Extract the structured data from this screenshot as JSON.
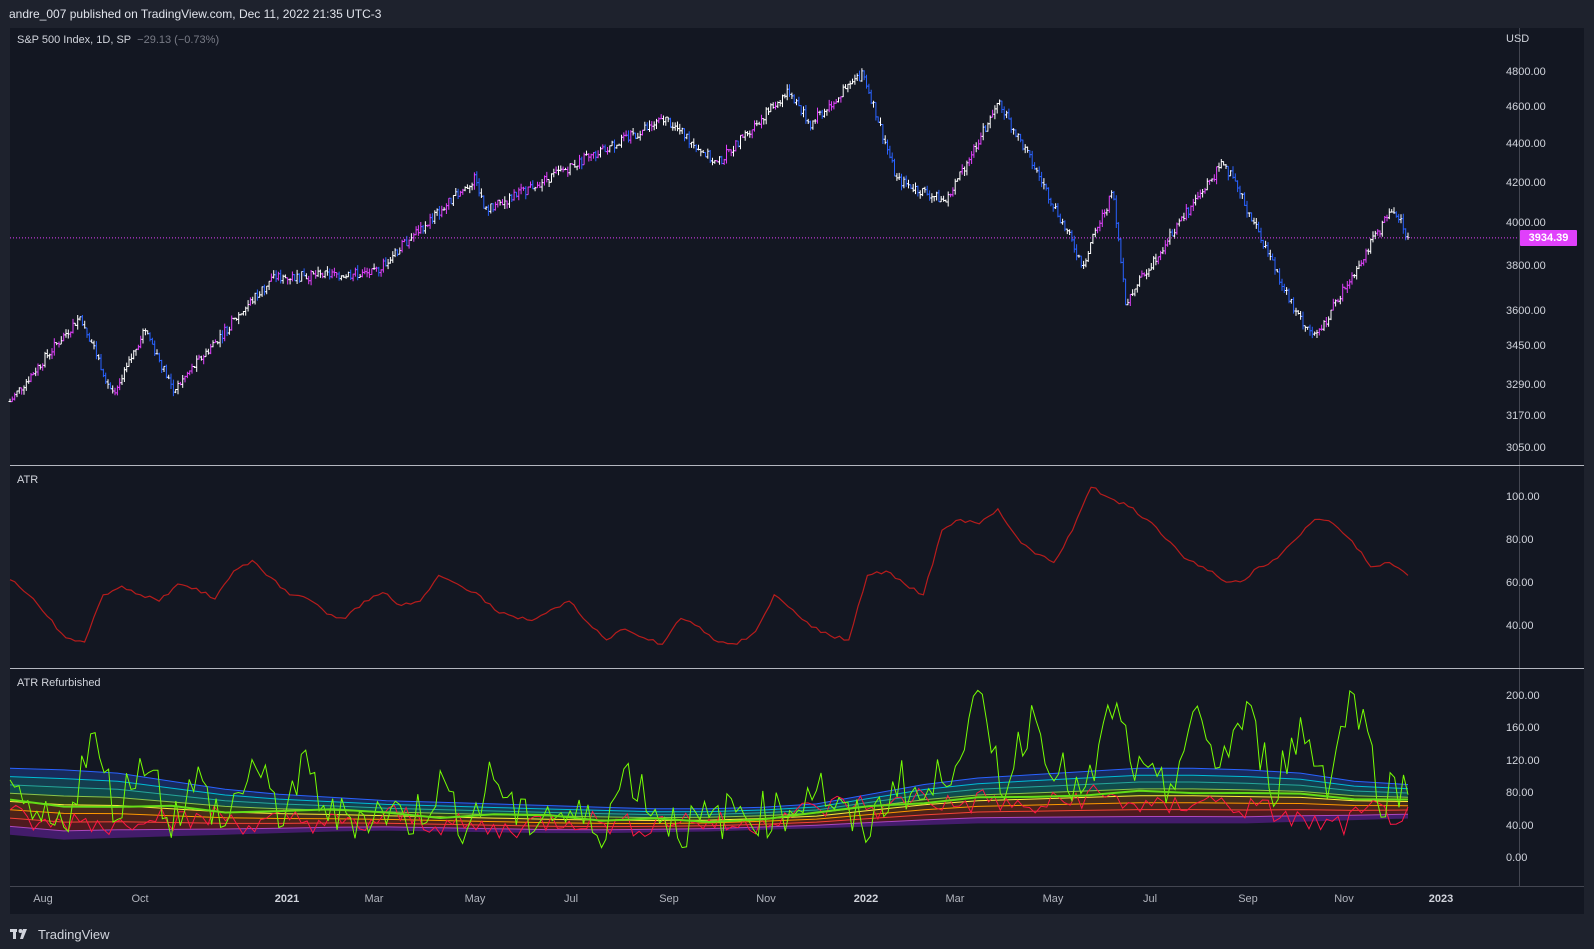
{
  "header": {
    "publish_text": "andre_007 published on TradingView.com, Dec 11, 2022 21:35 UTC-3"
  },
  "panes": {
    "main": {
      "symbol_label": "S&P 500 Index, 1D, SP",
      "change_label": "−29.13 (−0.73%)",
      "currency": "USD",
      "last_price": "3934.39",
      "price_ticks": [
        "4800.00",
        "4600.00",
        "4400.00",
        "4200.00",
        "4000.00",
        "3800.00",
        "3600.00",
        "3450.00",
        "3290.00",
        "3170.00",
        "3050.00"
      ]
    },
    "atr": {
      "label": "ATR",
      "ticks": [
        "100.00",
        "80.00",
        "60.00",
        "40.00"
      ]
    },
    "atr_refurbished": {
      "label": "ATR Refurbished",
      "ticks": [
        "200.00",
        "160.00",
        "120.00",
        "80.00",
        "40.00",
        "0.00"
      ]
    }
  },
  "time_axis": {
    "labels": [
      {
        "text": "Aug",
        "year": false
      },
      {
        "text": "Oct",
        "year": false
      },
      {
        "text": "2021",
        "year": true
      },
      {
        "text": "Mar",
        "year": false
      },
      {
        "text": "May",
        "year": false
      },
      {
        "text": "Jul",
        "year": false
      },
      {
        "text": "Sep",
        "year": false
      },
      {
        "text": "Nov",
        "year": false
      },
      {
        "text": "2022",
        "year": true
      },
      {
        "text": "Mar",
        "year": false
      },
      {
        "text": "May",
        "year": false
      },
      {
        "text": "Jul",
        "year": false
      },
      {
        "text": "Sep",
        "year": false
      },
      {
        "text": "Nov",
        "year": false
      },
      {
        "text": "2023",
        "year": true
      }
    ]
  },
  "footer": {
    "brand": "TradingView"
  },
  "colors": {
    "background": "#131722",
    "frame": "#1e222d",
    "bar_up": "#ffffff",
    "bar_down": "#2962ff",
    "bar_trend": "#e040fb",
    "atr_line": "#b71c1c",
    "atr_fast": "#76ff03",
    "atr_slow": "#ff1744",
    "price_line": "#e040fb"
  },
  "chart_data": [
    {
      "type": "ohlc",
      "title": "S&P 500 Index, 1D, SP",
      "x_range": [
        "2020-07",
        "2022-12"
      ],
      "ylim": [
        3000,
        4850
      ],
      "y_scale": "log",
      "last_value": 3934.39,
      "key_points": [
        {
          "date": "2020-07-20",
          "value": 3230
        },
        {
          "date": "2020-09-02",
          "value": 3580
        },
        {
          "date": "2020-09-23",
          "value": 3240
        },
        {
          "date": "2020-10-12",
          "value": 3530
        },
        {
          "date": "2020-10-30",
          "value": 3270
        },
        {
          "date": "2020-12-31",
          "value": 3750
        },
        {
          "date": "2021-03-04",
          "value": 3770
        },
        {
          "date": "2021-05-07",
          "value": 4230
        },
        {
          "date": "2021-05-12",
          "value": 4060
        },
        {
          "date": "2021-09-02",
          "value": 4540
        },
        {
          "date": "2021-10-04",
          "value": 4300
        },
        {
          "date": "2021-11-18",
          "value": 4700
        },
        {
          "date": "2021-12-01",
          "value": 4510
        },
        {
          "date": "2022-01-03",
          "value": 4800
        },
        {
          "date": "2022-01-24",
          "value": 4220
        },
        {
          "date": "2022-02-24",
          "value": 4110
        },
        {
          "date": "2022-03-29",
          "value": 4630
        },
        {
          "date": "2022-05-20",
          "value": 3810
        },
        {
          "date": "2022-06-08",
          "value": 4160
        },
        {
          "date": "2022-06-16",
          "value": 3640
        },
        {
          "date": "2022-08-16",
          "value": 4310
        },
        {
          "date": "2022-09-30",
          "value": 3590
        },
        {
          "date": "2022-10-13",
          "value": 3490
        },
        {
          "date": "2022-11-30",
          "value": 4080
        },
        {
          "date": "2022-12-09",
          "value": 3934.39
        }
      ]
    },
    {
      "type": "line",
      "title": "ATR",
      "ylim": [
        25,
        110
      ],
      "series": [
        {
          "values": [
            62,
            55,
            45,
            35,
            33,
            55,
            59,
            55,
            52,
            60,
            58,
            53,
            66,
            71,
            63,
            55,
            53,
            46,
            44,
            52,
            56,
            50,
            52,
            64,
            60,
            56,
            48,
            45,
            43,
            48,
            52,
            42,
            34,
            39,
            35,
            32,
            44,
            40,
            33,
            32,
            38,
            55,
            48,
            40,
            36,
            34,
            64,
            66,
            60,
            55,
            85,
            90,
            88,
            95,
            82,
            74,
            70,
            85,
            105,
            100,
            96,
            90,
            81,
            72,
            68,
            62,
            61,
            68,
            72,
            81,
            90,
            88,
            80,
            68,
            70,
            64
          ]
        }
      ]
    },
    {
      "type": "line",
      "title": "ATR Refurbished",
      "ylim": [
        0,
        210
      ],
      "bands": {
        "note": "stacked envelope bands from blue (upper) to purple (lower)",
        "upper_values": [
          112,
          110,
          106,
          96,
          86,
          80,
          76,
          72,
          70,
          68,
          66,
          64,
          62,
          62,
          64,
          68,
          80,
          92,
          100,
          104,
          108,
          112,
          112,
          110,
          106,
          96,
          92
        ],
        "lower_values": [
          30,
          24,
          26,
          28,
          30,
          32,
          34,
          35,
          34,
          33,
          32,
          32,
          33,
          34,
          36,
          38,
          40,
          42,
          44,
          44,
          44,
          44,
          44,
          44,
          46,
          48,
          50
        ]
      },
      "series": [
        {
          "values": [
            70,
            45,
            40,
            150,
            60,
            130,
            50,
            95,
            40,
            120,
            55,
            110,
            50,
            55,
            60,
            50,
            90,
            40,
            105,
            45,
            60,
            50,
            40,
            110,
            60,
            40,
            45,
            60,
            55,
            60,
            95,
            50,
            40,
            100,
            70,
            120,
            190,
            90,
            180,
            110,
            70,
            190,
            100,
            80,
            170,
            120,
            180,
            90,
            160,
            100,
            210,
            80,
            90
          ]
        },
        {
          "values": [
            55,
            40,
            50,
            40,
            60,
            45,
            55,
            40,
            50,
            45,
            40,
            55,
            45,
            40,
            35,
            45,
            50,
            45,
            40,
            50,
            45,
            40,
            55,
            60,
            70,
            60,
            80,
            65,
            75,
            60,
            70,
            80,
            70,
            60,
            75,
            65,
            60,
            45,
            40,
            60,
            50
          ]
        }
      ]
    }
  ]
}
